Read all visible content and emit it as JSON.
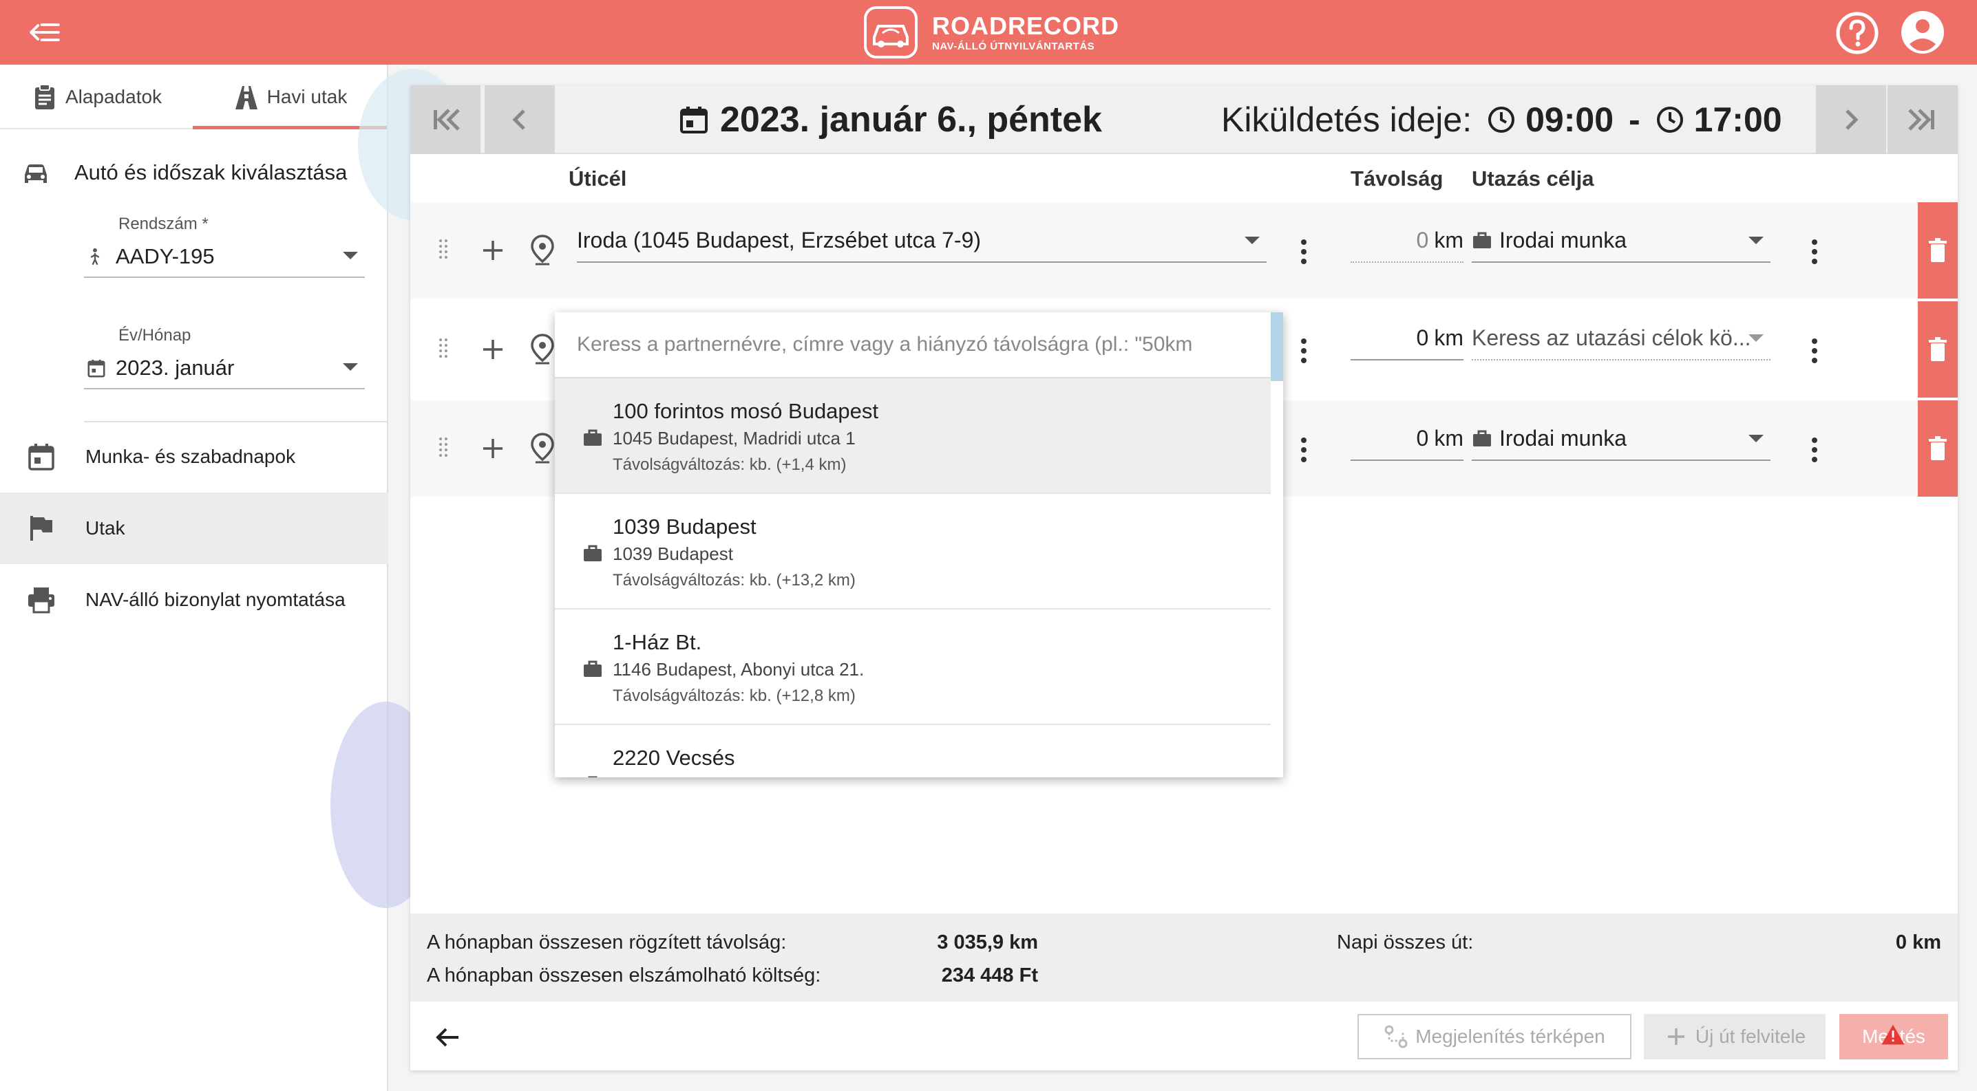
{
  "app": {
    "title": "ROADRECORD",
    "subtitle": "NAV-ÁLLÓ ÚTNYILVÁNTARTÁS",
    "accent_color": "#ee6f66",
    "icons": {
      "menu": "menu-back-icon",
      "help": "help-icon",
      "account": "account-icon"
    }
  },
  "sidebar": {
    "tabs": [
      {
        "label": "Alapadatok",
        "icon": "clipboard-icon",
        "active": false
      },
      {
        "label": "Havi utak",
        "icon": "road-icon",
        "active": true
      }
    ],
    "section_title": "Autó és időszak kiválasztása",
    "plate": {
      "label": "Rendszám *",
      "value": "AADY-195"
    },
    "month": {
      "label": "Év/Hónap",
      "value": "2023. január"
    },
    "nav": [
      {
        "label": "Munka- és szabadnapok",
        "icon": "calendar-icon",
        "active": false
      },
      {
        "label": "Utak",
        "icon": "flag-icon",
        "active": true
      },
      {
        "label": "NAV-álló bizonylat nyomtatása",
        "icon": "printer-icon",
        "active": false
      }
    ]
  },
  "day": {
    "date": "2023. január 6., péntek",
    "mission_label": "Kiküldetés ideje:",
    "start": "09:00",
    "sep": "-",
    "end": "17:00"
  },
  "columns": {
    "destination": "Úticél",
    "distance": "Távolság",
    "purpose": "Utazás célja"
  },
  "trips": [
    {
      "destination": "Iroda (1045 Budapest, Erzsébet utca 7-9)",
      "distance": "0",
      "unit": "km",
      "purpose": "Irodai munka"
    },
    {
      "destination": "",
      "distance": "0",
      "unit": "km",
      "purpose": "Keress az utazási célok kö..."
    },
    {
      "destination": "",
      "distance": "0",
      "unit": "km",
      "purpose": "Irodai munka"
    }
  ],
  "dropdown": {
    "placeholder": "Keress a partnernévre, címre vagy a hiányzó távolságra (pl.: \"50km",
    "options": [
      {
        "name": "100 forintos mosó Budapest",
        "address": "1045 Budapest, Madridi utca 1",
        "delta": "Távolságváltozás: kb. (+1,4 km)"
      },
      {
        "name": "1039 Budapest",
        "address": "1039 Budapest",
        "delta": "Távolságváltozás: kb. (+13,2 km)"
      },
      {
        "name": "1-Ház Bt.",
        "address": "1146 Budapest, Abonyi utca 21.",
        "delta": "Távolságváltozás: kb. (+12,8 km)"
      },
      {
        "name": "2220 Vecsés",
        "address": "",
        "delta": ""
      }
    ]
  },
  "summary": {
    "distance_label": "A hónapban összesen rögzített távolság:",
    "distance_value": "3 035,9 km",
    "cost_label": "A hónapban összesen elszámolható költség:",
    "cost_value": "234 448 Ft",
    "daily_label": "Napi összes út:",
    "daily_value": "0 km"
  },
  "buttons": {
    "map": "Megjelenítés térképen",
    "new_trip": "Új út felvitele",
    "save": "Mentés"
  }
}
